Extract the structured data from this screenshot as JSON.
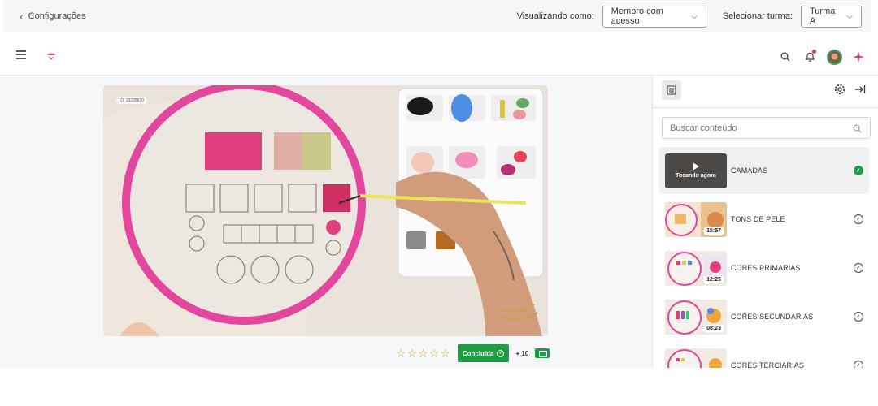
{
  "adminbar": {
    "back_label": "Configurações",
    "viewing_label": "Visualizando como:",
    "viewing_value": "Membro com acesso",
    "class_label": "Selecionar turma:",
    "class_value": "Turma A"
  },
  "header": {
    "icons": [
      "menu-icon",
      "logo-icon",
      "search-icon",
      "bell-icon",
      "avatar",
      "sparkle-icon"
    ],
    "notification_dot_color": "#e53935"
  },
  "video": {
    "id_text": "ID: 13228930"
  },
  "actions": {
    "rating_stars": 5,
    "rating_value": 0,
    "completed_label": "Concluída",
    "points_label": "+ 10"
  },
  "sidebar": {
    "search_placeholder": "Buscar conteúdo",
    "lessons": [
      {
        "title": "CAMADAS",
        "status": "done",
        "now_playing": "Tocando agora",
        "duration": ""
      },
      {
        "title": "TONS DE PELE",
        "status": "pending",
        "duration": "15:57"
      },
      {
        "title": "CORES PRIMARIAS",
        "status": "pending",
        "duration": "12:25"
      },
      {
        "title": "CORES SECUNDARIAS",
        "status": "pending",
        "duration": "08:23"
      },
      {
        "title": "CORES TERCIARIAS",
        "status": "pending",
        "duration": ""
      }
    ]
  },
  "colors": {
    "accent_green": "#1f9d45",
    "brand_pink": "#d63384"
  }
}
